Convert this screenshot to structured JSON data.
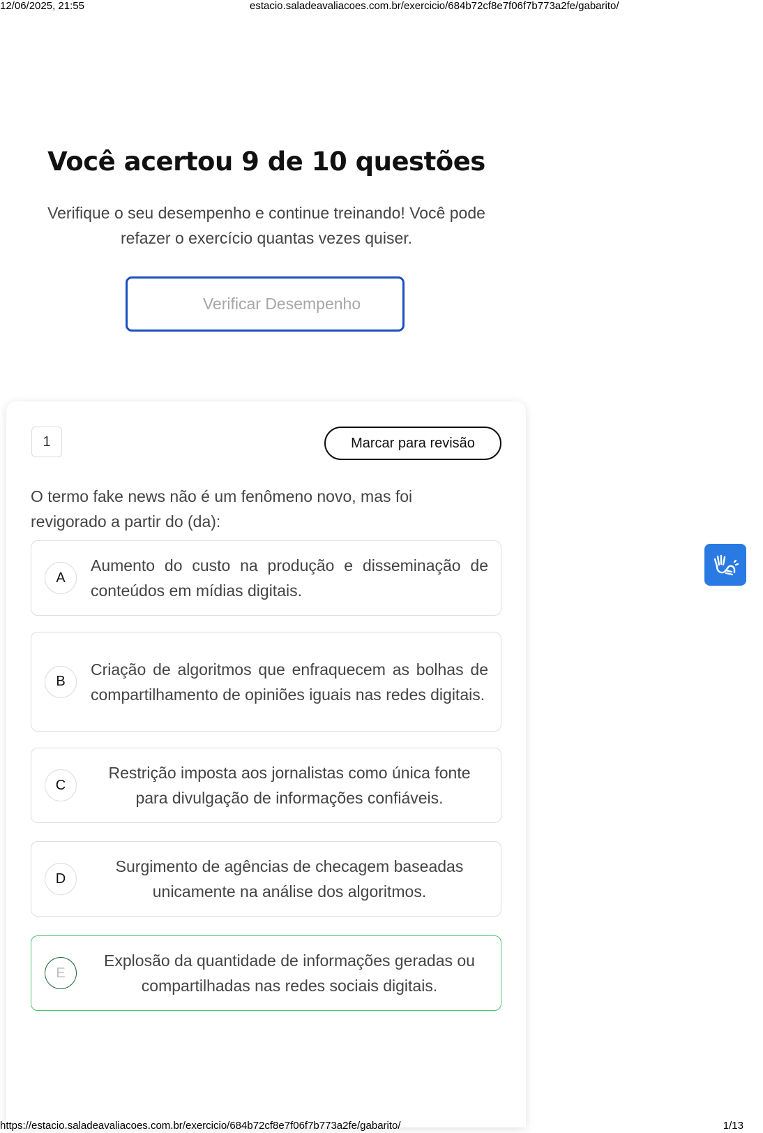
{
  "print": {
    "timestamp": "12/06/2025, 21:55",
    "header_url": "estacio.saladeavaliacoes.com.br/exercicio/684b72cf8e7f06f7b773a2fe/gabarito/",
    "footer_url": "https://estacio.saladeavaliacoes.com.br/exercicio/684b72cf8e7f06f7b773a2fe/gabarito/",
    "page_number": "1/13"
  },
  "result": {
    "title": "Você acertou 9 de 10 questões",
    "subtitle": "Verifique o seu desempenho e continue treinando! Você pode refazer o exercício quantas vezes quiser.",
    "verify_button": "Verificar Desempenho"
  },
  "question": {
    "number": "1",
    "review_button": "Marcar para revisão",
    "statement": "O termo fake news não é um fenômeno novo, mas foi revigorado a partir do (da):",
    "options": [
      {
        "letter": "A",
        "text": "Aumento do custo na produção e disseminação de conteúdos em mídias digitais."
      },
      {
        "letter": "B",
        "text": "Criação de algoritmos que enfraquecem as bolhas de compartilhamento de opiniões iguais nas redes digitais."
      },
      {
        "letter": "C",
        "text": "Restrição imposta aos jornalistas como única fonte para divulgação de informações confiáveis."
      },
      {
        "letter": "D",
        "text": "Surgimento de agências de checagem baseadas unicamente na análise dos algoritmos."
      },
      {
        "letter": "E",
        "text": "Explosão da quantidade de informações geradas ou compartilhadas nas redes sociais digitais."
      }
    ],
    "correct_option": "E"
  },
  "accessibility": {
    "icon": "sign-language-hands-icon",
    "color": "#2a7ae4"
  },
  "colors": {
    "primary_border": "#1b4fc2",
    "correct_border": "#4cc46a"
  }
}
